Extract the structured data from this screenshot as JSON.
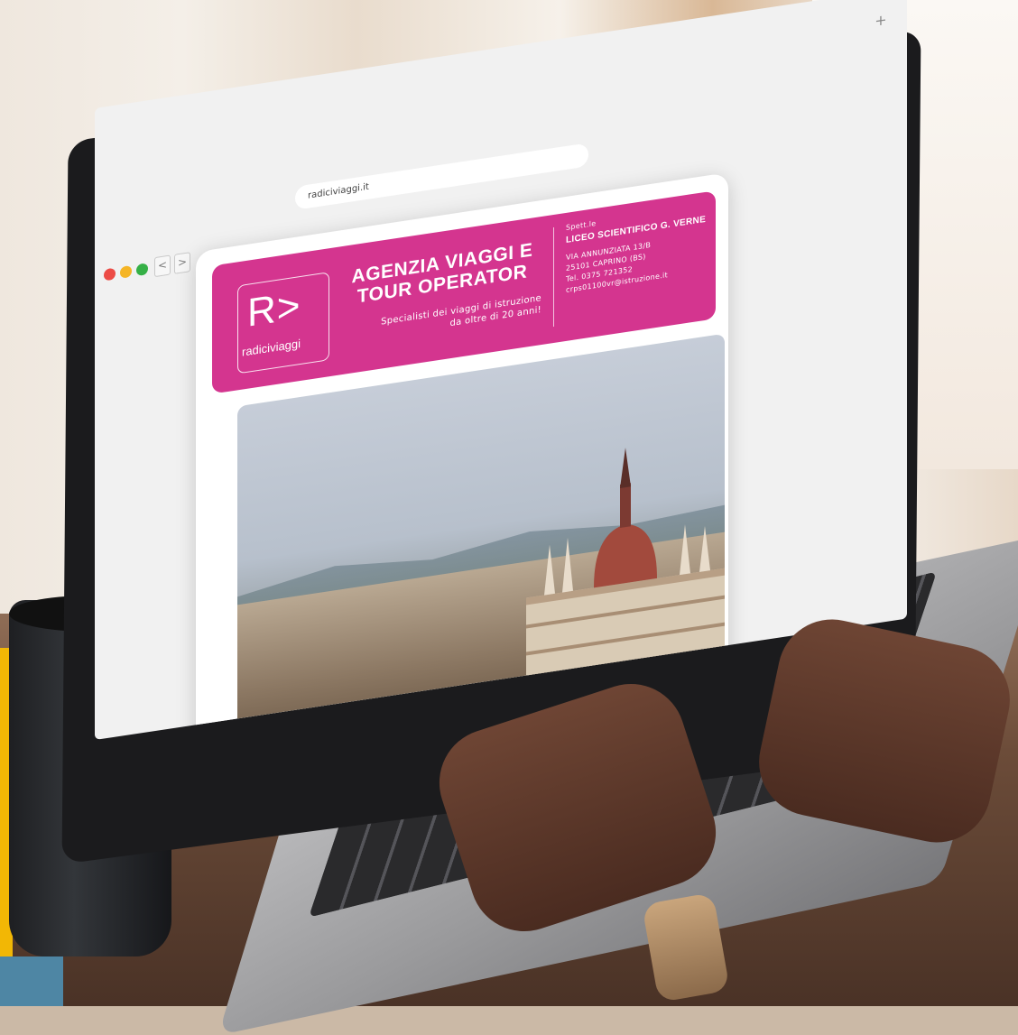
{
  "browser": {
    "url": "radiciviaggi.it",
    "back_glyph": "<",
    "forward_glyph": ">",
    "new_tab_glyph": "+",
    "traffic_lights": [
      "#ec4b45",
      "#f5b526",
      "#35b046"
    ]
  },
  "brand": {
    "logo_mark": "R>",
    "logo_text": "radiciviaggi",
    "accent_color": "#d4358f"
  },
  "banner": {
    "headline_line1": "AGENZIA VIAGGI E",
    "headline_line2": "TOUR OPERATOR",
    "tagline_line1": "Specialisti dei viaggi di istruzione",
    "tagline_line2": "da oltre di 20 anni!"
  },
  "recipient": {
    "label": "Spett.le",
    "name": "LICEO SCIENTIFICO G. VERNE",
    "address_line1": "VIA ANNUNZIATA 13/B",
    "address_line2": "25101 CAPRINO (BS)",
    "phone": "Tel. 0375 721352",
    "email": "crps01100vr@istruzione.it"
  },
  "icons": {
    "back": "chevron-left-icon",
    "forward": "chevron-right-icon",
    "new_tab": "plus-icon"
  }
}
